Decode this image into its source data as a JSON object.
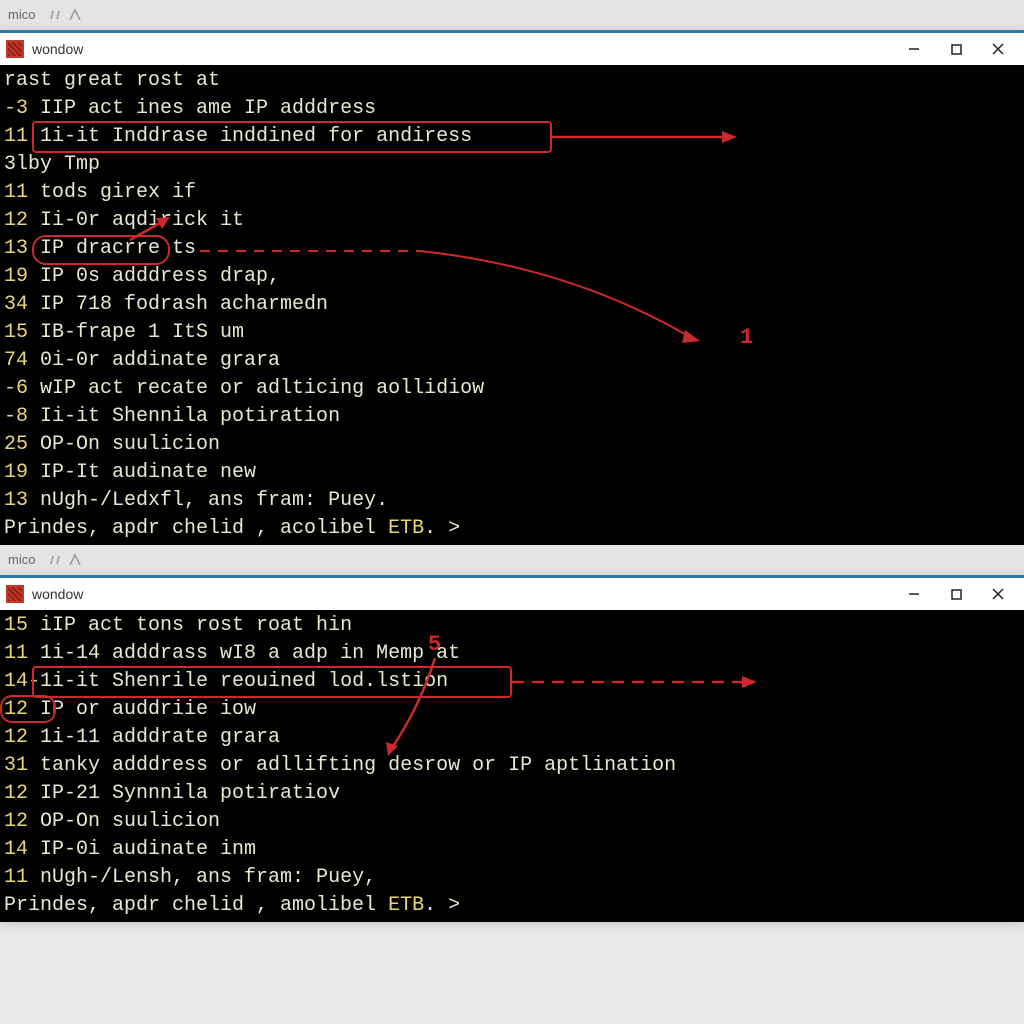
{
  "tabs": {
    "label": "mico"
  },
  "window1": {
    "title": "wondow",
    "lines": [
      {
        "num": "",
        "text": "rast great rost at"
      },
      {
        "num": "-3 ",
        "text": "IIP act ines ame IP adddress"
      },
      {
        "num": "11 ",
        "text": "1i-it Inddrase inddined for andiress"
      },
      {
        "num": "",
        "text": "3lby Tmp"
      },
      {
        "num": "11 ",
        "text": "tods girex if"
      },
      {
        "num": "12 ",
        "text": "Ii-0r aqdirick it"
      },
      {
        "num": "13 ",
        "text": "IP dracrre ts"
      },
      {
        "num": "19 ",
        "text": "IP 0s adddress drap,"
      },
      {
        "num": "34 ",
        "text": "IP 718 fodrash acharmedn"
      },
      {
        "num": "15 ",
        "text": "IB-frape 1 ItS um"
      },
      {
        "num": "74 ",
        "text": "0i-0r addinate grara"
      },
      {
        "num": "-6 ",
        "text": "wIP act recate or adlticing aollidiow"
      },
      {
        "num": "-8 ",
        "text": "Ii-it Shennila potiration"
      },
      {
        "num": "25 ",
        "text": "OP-On suulicion"
      },
      {
        "num": "19 ",
        "text": "IP-It audinate new"
      },
      {
        "num": "13 ",
        "text": "nUgh-/Ledxfl, ans fram: Puey."
      }
    ],
    "prompt": "Prindes, apdr chelid , acolibel ETB. >",
    "annotations": {
      "label1": "1"
    }
  },
  "window2": {
    "title": "wondow",
    "lines": [
      {
        "num": "15 ",
        "text": "iIP act tons rost roat hin"
      },
      {
        "num": "11 ",
        "text": "1i-14 adddrass wI8 a adp in Memp at"
      },
      {
        "num": "14-",
        "text": "1i-it Shenrile reouined lod.lstion"
      },
      {
        "num": "12 ",
        "text": "IP or auddriie iow"
      },
      {
        "num": "12 ",
        "text": "1i-11 adddrate grara"
      },
      {
        "num": "31 ",
        "text": "tanky adddress or adllifting desrow or IP aptlination"
      },
      {
        "num": "12 ",
        "text": "IP-21 Synnnila potiratiov"
      },
      {
        "num": "12 ",
        "text": "OP-On suulicion"
      },
      {
        "num": "14 ",
        "text": "IP-0i audinate inm"
      },
      {
        "num": "11 ",
        "text": "nUgh-/Lensh, ans fram: Puey,"
      }
    ],
    "prompt": "Prindes, apdr chelid , amolibel ETB. >",
    "annotations": {
      "label5": "5"
    }
  }
}
